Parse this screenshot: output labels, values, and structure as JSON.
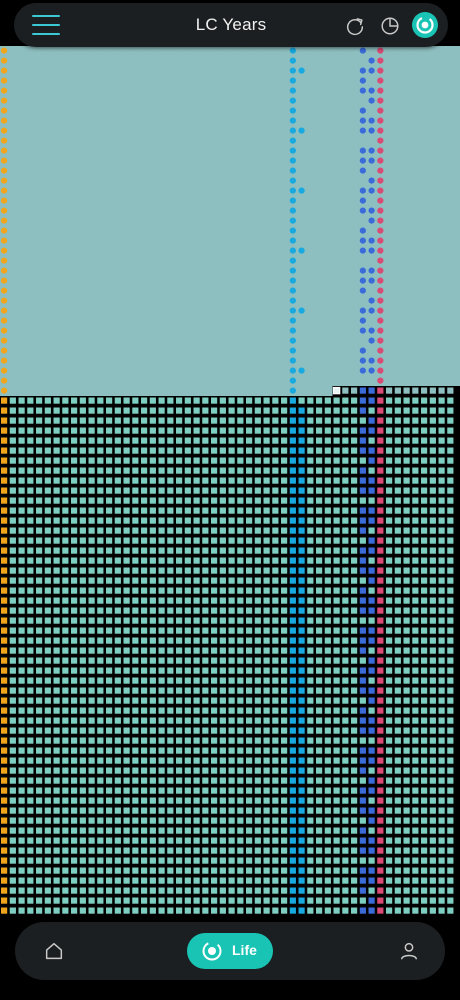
{
  "header": {
    "title": "LC Years",
    "menu_icon": "hamburger-menu-icon",
    "refresh_icon": "refresh-icon",
    "chart_icon": "pie-chart-icon",
    "brand_icon": "lifecalendar-logo-icon"
  },
  "grid": {
    "icon": "week-grid",
    "colors": {
      "past_week": "#8ebfc0",
      "future_week": "#7ecfc2",
      "background_past": "#8ebfc0",
      "background_future": "#000000",
      "year_start": "#f0a51c",
      "marker_light_blue": "#17a9df",
      "marker_dark_blue": "#3a6bd8",
      "marker_pink": "#d94a74",
      "current_week": "#e8f4f3"
    }
  },
  "nav": {
    "home_icon": "home-icon",
    "life_label": "Life",
    "life_icon": "life-ring-icon",
    "profile_icon": "person-icon",
    "accent": "#19c4b4"
  }
}
